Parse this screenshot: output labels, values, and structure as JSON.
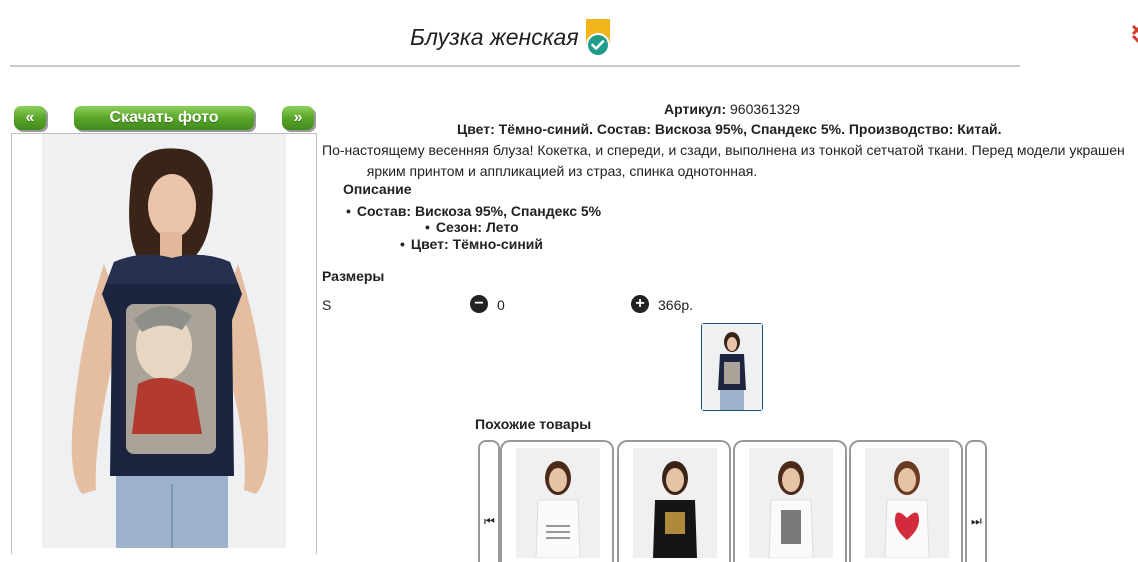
{
  "product": {
    "title": "Блузка женская",
    "article_label": "Артикул:",
    "article_value": "960361329",
    "composition_line": "Цвет: Тёмно-синий. Состав: Вискоза 95%, Спандекс 5%. Производство: Китай.",
    "description_line1": "По-настоящему весенняя блуза! Кокетка, и спереди, и сзади, выполнена из тонкой сетчатой ткани. Перед модели украшен",
    "description_line2": "ярким принтом и аппликацией из страз, спинка однотонная."
  },
  "nav": {
    "prev_label": "«",
    "download_label": "Скачать фото",
    "next_label": "»"
  },
  "details": {
    "title": "Описание",
    "items": [
      "Состав: Вискоза 95%, Спандекс 5%",
      "Сезон: Лето",
      "Цвет: Тёмно-синий"
    ]
  },
  "sizes": {
    "title": "Размеры",
    "rows": [
      {
        "size": "S",
        "minus_icon": "minus-circle-icon",
        "quantity": "0",
        "plus_icon": "plus-circle-icon",
        "price": "366р."
      }
    ]
  },
  "similar": {
    "title": "Похожие товары",
    "prev_icon": "skip-left-icon",
    "next_icon": "skip-right-icon",
    "prev_glyph": "⏮",
    "next_glyph": "⏭"
  },
  "colors": {
    "button_green": "#5aa62a",
    "badge_yellow": "#f3b51c",
    "badge_teal": "#1f9c8a",
    "close_red": "#d23a2a"
  }
}
